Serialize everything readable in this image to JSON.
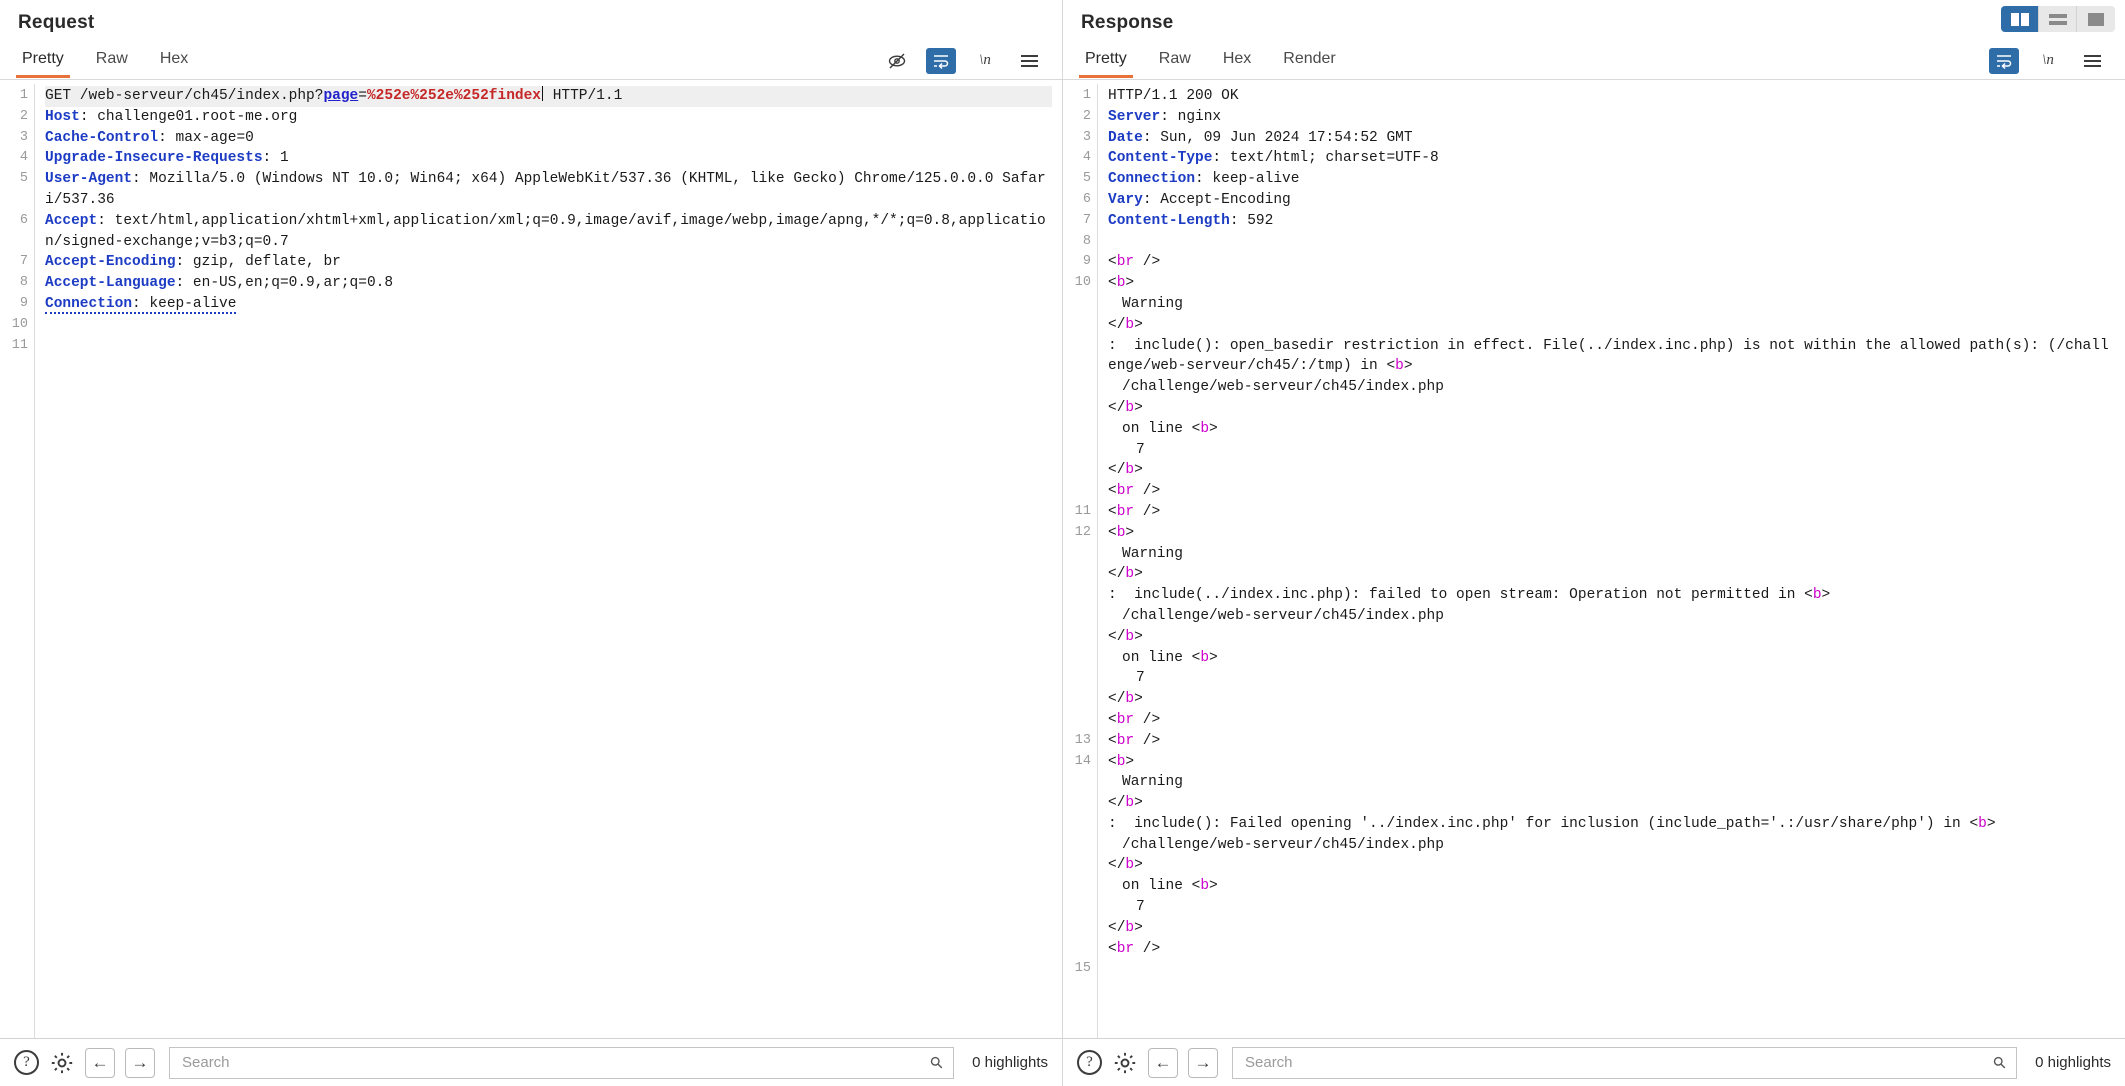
{
  "window": {
    "layout_buttons": [
      {
        "name": "side-by-side",
        "active": true
      },
      {
        "name": "top-bottom",
        "active": false
      },
      {
        "name": "single",
        "active": false
      }
    ]
  },
  "request": {
    "title": "Request",
    "tabs": [
      {
        "label": "Pretty",
        "active": true
      },
      {
        "label": "Raw",
        "active": false
      },
      {
        "label": "Hex",
        "active": false
      }
    ],
    "tools": [
      {
        "name": "hide-icon",
        "label": "",
        "active": false
      },
      {
        "name": "word-wrap-icon",
        "label": "",
        "active": true
      },
      {
        "name": "show-newlines-icon",
        "label": "\\n",
        "active": false
      },
      {
        "name": "menu-icon",
        "label": "",
        "active": false
      }
    ],
    "line_numbers": [
      "1",
      "2",
      "3",
      "4",
      "5",
      "",
      "6",
      "",
      "",
      "7",
      "8",
      "9",
      "10",
      "11"
    ],
    "lines": [
      {
        "n": "1",
        "highlight": true,
        "parts": [
          {
            "t": "GET /web-serveur/ch45/index.php?",
            "c": "plain"
          },
          {
            "t": "page",
            "c": "param"
          },
          {
            "t": "=",
            "c": "plain"
          },
          {
            "t": "%252e%252e%252findex",
            "c": "pval"
          },
          {
            "t": "caret",
            "c": "caret"
          },
          {
            "t": " HTTP/1.1",
            "c": "plain"
          }
        ]
      },
      {
        "n": "2",
        "parts": [
          {
            "t": "Host",
            "c": "hname"
          },
          {
            "t": ": challenge01.root-me.org",
            "c": "plain"
          }
        ]
      },
      {
        "n": "3",
        "parts": [
          {
            "t": "Cache-Control",
            "c": "hname"
          },
          {
            "t": ": max-age=0",
            "c": "plain"
          }
        ]
      },
      {
        "n": "4",
        "parts": [
          {
            "t": "Upgrade-Insecure-Requests",
            "c": "hname"
          },
          {
            "t": ": 1",
            "c": "plain"
          }
        ]
      },
      {
        "n": "5",
        "parts": [
          {
            "t": "User-Agent",
            "c": "hname"
          },
          {
            "t": ": Mozilla/5.0 (Windows NT 10.0; Win64; x64) AppleWebKit/537.36 (KHTML, like Gecko) Chrome/125.0.0.0 Safari/537.36",
            "c": "plain"
          }
        ]
      },
      {
        "n": "6",
        "parts": [
          {
            "t": "Accept",
            "c": "hname"
          },
          {
            "t": ": text/html,application/xhtml+xml,application/xml;q=0.9,image/avif,image/webp,image/apng,*/*;q=0.8,application/signed-exchange;v=b3;q=0.7",
            "c": "plain"
          }
        ]
      },
      {
        "n": "7",
        "parts": [
          {
            "t": "Accept-Encoding",
            "c": "hname"
          },
          {
            "t": ": gzip, deflate, br",
            "c": "plain"
          }
        ]
      },
      {
        "n": "8",
        "parts": [
          {
            "t": "Accept-Language",
            "c": "hname"
          },
          {
            "t": ": en-US,en;q=0.9,ar;q=0.8",
            "c": "plain"
          }
        ]
      },
      {
        "n": "9",
        "dotted": true,
        "parts": [
          {
            "t": "Connection",
            "c": "hname"
          },
          {
            "t": ": keep-alive",
            "c": "plain"
          }
        ]
      },
      {
        "n": "10",
        "parts": [
          {
            "t": "",
            "c": "plain"
          }
        ]
      },
      {
        "n": "11",
        "parts": [
          {
            "t": "",
            "c": "plain"
          }
        ]
      }
    ],
    "search": {
      "placeholder": "Search",
      "value": ""
    },
    "highlights_label": "0 highlights"
  },
  "response": {
    "title": "Response",
    "tabs": [
      {
        "label": "Pretty",
        "active": true
      },
      {
        "label": "Raw",
        "active": false
      },
      {
        "label": "Hex",
        "active": false
      },
      {
        "label": "Render",
        "active": false
      }
    ],
    "tools": [
      {
        "name": "word-wrap-icon",
        "label": "",
        "active": true
      },
      {
        "name": "show-newlines-icon",
        "label": "\\n",
        "active": false
      },
      {
        "name": "menu-icon",
        "label": "",
        "active": false
      }
    ],
    "lines": [
      {
        "n": "1",
        "parts": [
          {
            "t": "HTTP/1.1 200 OK",
            "c": "plain"
          }
        ]
      },
      {
        "n": "2",
        "parts": [
          {
            "t": "Server",
            "c": "hname"
          },
          {
            "t": ": nginx",
            "c": "plain"
          }
        ]
      },
      {
        "n": "3",
        "parts": [
          {
            "t": "Date",
            "c": "hname"
          },
          {
            "t": ": Sun, 09 Jun 2024 17:54:52 GMT",
            "c": "plain"
          }
        ]
      },
      {
        "n": "4",
        "parts": [
          {
            "t": "Content-Type",
            "c": "hname"
          },
          {
            "t": ": text/html; charset=UTF-8",
            "c": "plain"
          }
        ]
      },
      {
        "n": "5",
        "parts": [
          {
            "t": "Connection",
            "c": "hname"
          },
          {
            "t": ": keep-alive",
            "c": "plain"
          }
        ]
      },
      {
        "n": "6",
        "parts": [
          {
            "t": "Vary",
            "c": "hname"
          },
          {
            "t": ": Accept-Encoding",
            "c": "plain"
          }
        ]
      },
      {
        "n": "7",
        "parts": [
          {
            "t": "Content-Length",
            "c": "hname"
          },
          {
            "t": ": 592",
            "c": "plain"
          }
        ]
      },
      {
        "n": "8",
        "parts": [
          {
            "t": "",
            "c": "plain"
          }
        ]
      },
      {
        "n": "9",
        "parts": [
          {
            "t": "<",
            "c": "tagbr"
          },
          {
            "t": "br",
            "c": "tagp"
          },
          {
            "t": " />",
            "c": "tagbr"
          }
        ]
      },
      {
        "n": "10",
        "parts": [
          {
            "t": "<",
            "c": "tagbr"
          },
          {
            "t": "b",
            "c": "tagp"
          },
          {
            "t": ">",
            "c": "tagbr"
          }
        ]
      },
      {
        "n": "",
        "indent": 1,
        "parts": [
          {
            "t": "Warning",
            "c": "plain"
          }
        ]
      },
      {
        "n": "",
        "parts": [
          {
            "t": "</",
            "c": "tagbr"
          },
          {
            "t": "b",
            "c": "tagp"
          },
          {
            "t": ">",
            "c": "tagbr"
          }
        ]
      },
      {
        "n": "",
        "parts": [
          {
            "t": ":  include(): open_basedir restriction in effect. File(../index.inc.php) is not within the allowed path(s): (/challenge/web-serveur/ch45/:/tmp) in ",
            "c": "plain"
          },
          {
            "t": "<",
            "c": "tagbr"
          },
          {
            "t": "b",
            "c": "tagp"
          },
          {
            "t": ">",
            "c": "tagbr"
          }
        ]
      },
      {
        "n": "",
        "indent": 1,
        "parts": [
          {
            "t": "/challenge/web-serveur/ch45/index.php",
            "c": "plain"
          }
        ]
      },
      {
        "n": "",
        "parts": [
          {
            "t": "</",
            "c": "tagbr"
          },
          {
            "t": "b",
            "c": "tagp"
          },
          {
            "t": ">",
            "c": "tagbr"
          }
        ]
      },
      {
        "n": "",
        "indent": 1,
        "parts": [
          {
            "t": "on line ",
            "c": "plain"
          },
          {
            "t": "<",
            "c": "tagbr"
          },
          {
            "t": "b",
            "c": "tagp"
          },
          {
            "t": ">",
            "c": "tagbr"
          }
        ]
      },
      {
        "n": "",
        "indent": 2,
        "parts": [
          {
            "t": "7",
            "c": "plain"
          }
        ]
      },
      {
        "n": "",
        "parts": [
          {
            "t": "</",
            "c": "tagbr"
          },
          {
            "t": "b",
            "c": "tagp"
          },
          {
            "t": ">",
            "c": "tagbr"
          }
        ]
      },
      {
        "n": "",
        "parts": [
          {
            "t": "<",
            "c": "tagbr"
          },
          {
            "t": "br",
            "c": "tagp"
          },
          {
            "t": " />",
            "c": "tagbr"
          }
        ]
      },
      {
        "n": "11",
        "parts": [
          {
            "t": "<",
            "c": "tagbr"
          },
          {
            "t": "br",
            "c": "tagp"
          },
          {
            "t": " />",
            "c": "tagbr"
          }
        ]
      },
      {
        "n": "12",
        "parts": [
          {
            "t": "<",
            "c": "tagbr"
          },
          {
            "t": "b",
            "c": "tagp"
          },
          {
            "t": ">",
            "c": "tagbr"
          }
        ]
      },
      {
        "n": "",
        "indent": 1,
        "parts": [
          {
            "t": "Warning",
            "c": "plain"
          }
        ]
      },
      {
        "n": "",
        "parts": [
          {
            "t": "</",
            "c": "tagbr"
          },
          {
            "t": "b",
            "c": "tagp"
          },
          {
            "t": ">",
            "c": "tagbr"
          }
        ]
      },
      {
        "n": "",
        "parts": [
          {
            "t": ":  include(../index.inc.php): failed to open stream: Operation not permitted in ",
            "c": "plain"
          },
          {
            "t": "<",
            "c": "tagbr"
          },
          {
            "t": "b",
            "c": "tagp"
          },
          {
            "t": ">",
            "c": "tagbr"
          }
        ]
      },
      {
        "n": "",
        "indent": 1,
        "parts": [
          {
            "t": "/challenge/web-serveur/ch45/index.php",
            "c": "plain"
          }
        ]
      },
      {
        "n": "",
        "parts": [
          {
            "t": "</",
            "c": "tagbr"
          },
          {
            "t": "b",
            "c": "tagp"
          },
          {
            "t": ">",
            "c": "tagbr"
          }
        ]
      },
      {
        "n": "",
        "indent": 1,
        "parts": [
          {
            "t": "on line ",
            "c": "plain"
          },
          {
            "t": "<",
            "c": "tagbr"
          },
          {
            "t": "b",
            "c": "tagp"
          },
          {
            "t": ">",
            "c": "tagbr"
          }
        ]
      },
      {
        "n": "",
        "indent": 2,
        "parts": [
          {
            "t": "7",
            "c": "plain"
          }
        ]
      },
      {
        "n": "",
        "parts": [
          {
            "t": "</",
            "c": "tagbr"
          },
          {
            "t": "b",
            "c": "tagp"
          },
          {
            "t": ">",
            "c": "tagbr"
          }
        ]
      },
      {
        "n": "",
        "parts": [
          {
            "t": "<",
            "c": "tagbr"
          },
          {
            "t": "br",
            "c": "tagp"
          },
          {
            "t": " />",
            "c": "tagbr"
          }
        ]
      },
      {
        "n": "13",
        "parts": [
          {
            "t": "<",
            "c": "tagbr"
          },
          {
            "t": "br",
            "c": "tagp"
          },
          {
            "t": " />",
            "c": "tagbr"
          }
        ]
      },
      {
        "n": "14",
        "parts": [
          {
            "t": "<",
            "c": "tagbr"
          },
          {
            "t": "b",
            "c": "tagp"
          },
          {
            "t": ">",
            "c": "tagbr"
          }
        ]
      },
      {
        "n": "",
        "indent": 1,
        "parts": [
          {
            "t": "Warning",
            "c": "plain"
          }
        ]
      },
      {
        "n": "",
        "parts": [
          {
            "t": "</",
            "c": "tagbr"
          },
          {
            "t": "b",
            "c": "tagp"
          },
          {
            "t": ">",
            "c": "tagbr"
          }
        ]
      },
      {
        "n": "",
        "parts": [
          {
            "t": ":  include(): Failed opening '../index.inc.php' for inclusion (include_path='.:/usr/share/php') in ",
            "c": "plain"
          },
          {
            "t": "<",
            "c": "tagbr"
          },
          {
            "t": "b",
            "c": "tagp"
          },
          {
            "t": ">",
            "c": "tagbr"
          }
        ]
      },
      {
        "n": "",
        "indent": 1,
        "parts": [
          {
            "t": "/challenge/web-serveur/ch45/index.php",
            "c": "plain"
          }
        ]
      },
      {
        "n": "",
        "parts": [
          {
            "t": "</",
            "c": "tagbr"
          },
          {
            "t": "b",
            "c": "tagp"
          },
          {
            "t": ">",
            "c": "tagbr"
          }
        ]
      },
      {
        "n": "",
        "indent": 1,
        "parts": [
          {
            "t": "on line ",
            "c": "plain"
          },
          {
            "t": "<",
            "c": "tagbr"
          },
          {
            "t": "b",
            "c": "tagp"
          },
          {
            "t": ">",
            "c": "tagbr"
          }
        ]
      },
      {
        "n": "",
        "indent": 2,
        "parts": [
          {
            "t": "7",
            "c": "plain"
          }
        ]
      },
      {
        "n": "",
        "parts": [
          {
            "t": "</",
            "c": "tagbr"
          },
          {
            "t": "b",
            "c": "tagp"
          },
          {
            "t": ">",
            "c": "tagbr"
          }
        ]
      },
      {
        "n": "",
        "parts": [
          {
            "t": "<",
            "c": "tagbr"
          },
          {
            "t": "br",
            "c": "tagp"
          },
          {
            "t": " />",
            "c": "tagbr"
          }
        ]
      },
      {
        "n": "15",
        "parts": [
          {
            "t": "",
            "c": "plain"
          }
        ]
      }
    ],
    "search": {
      "placeholder": "Search",
      "value": ""
    },
    "highlights_label": "0 highlights"
  }
}
